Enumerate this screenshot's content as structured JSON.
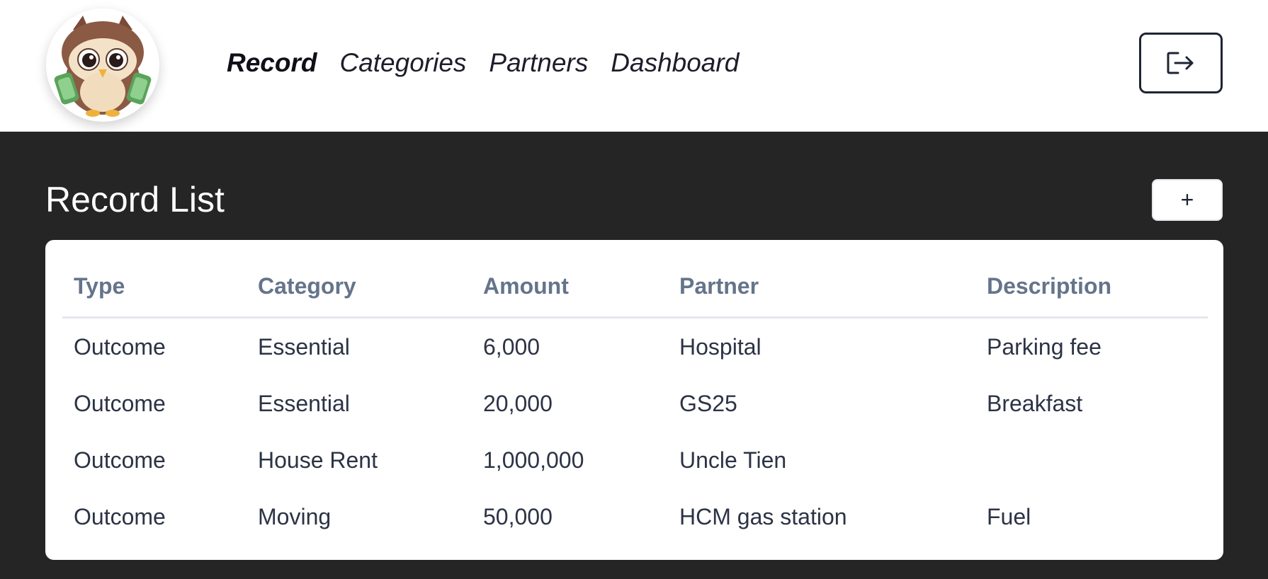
{
  "nav": {
    "items": [
      {
        "label": "Record",
        "active": true
      },
      {
        "label": "Categories",
        "active": false
      },
      {
        "label": "Partners",
        "active": false
      },
      {
        "label": "Dashboard",
        "active": false
      }
    ],
    "logout_icon": "logout-icon"
  },
  "main": {
    "title": "Record List",
    "add_label": "+",
    "table": {
      "headers": [
        "Type",
        "Category",
        "Amount",
        "Partner",
        "Description"
      ],
      "rows": [
        [
          "Outcome",
          "Essential",
          "6,000",
          "Hospital",
          "Parking fee"
        ],
        [
          "Outcome",
          "Essential",
          "20,000",
          "GS25",
          "Breakfast"
        ],
        [
          "Outcome",
          "House Rent",
          "1,000,000",
          "Uncle Tien",
          ""
        ],
        [
          "Outcome",
          "Moving",
          "50,000",
          "HCM gas station",
          "Fuel"
        ]
      ]
    }
  },
  "colors": {
    "page_bg": "#252525",
    "header_bg": "#ffffff",
    "header_text": "#64748b",
    "cell_text": "#2c3345"
  }
}
